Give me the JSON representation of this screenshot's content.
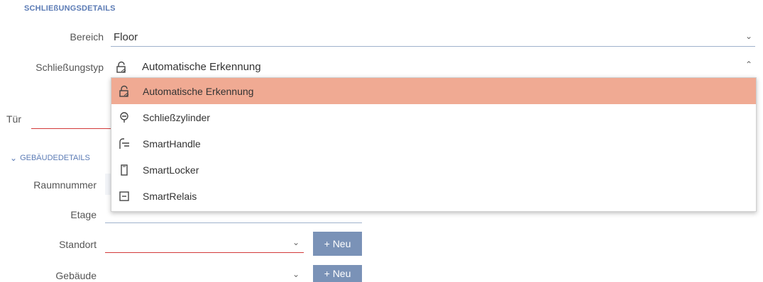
{
  "section_header": "SCHLIEßUNGSDETAILS",
  "bereich": {
    "label": "Bereich",
    "value": "Floor"
  },
  "schliessungstyp": {
    "label": "Schließungstyp",
    "value": "Automatische Erkennung",
    "options": [
      {
        "label": "Automatische Erkennung",
        "icon": "lock-auto-icon",
        "selected": true
      },
      {
        "label": "Schließzylinder",
        "icon": "cylinder-icon",
        "selected": false
      },
      {
        "label": "SmartHandle",
        "icon": "handle-icon",
        "selected": false
      },
      {
        "label": "SmartLocker",
        "icon": "locker-icon",
        "selected": false
      },
      {
        "label": "SmartRelais",
        "icon": "relay-icon",
        "selected": false
      }
    ]
  },
  "tuer": {
    "label": "Tür"
  },
  "gebaeude_section": {
    "label": "GEBÄUDEDETAILS"
  },
  "raumnummer": {
    "label": "Raumnummer"
  },
  "etage": {
    "label": "Etage"
  },
  "standort": {
    "label": "Standort",
    "button": "+ Neu"
  },
  "gebaeude": {
    "label": "Gebäude",
    "button": "+ Neu"
  },
  "colors": {
    "accent": "#5b7bb5",
    "selected_option": "#f0aa93",
    "error": "#d23a3a",
    "button": "#7a92b7"
  }
}
